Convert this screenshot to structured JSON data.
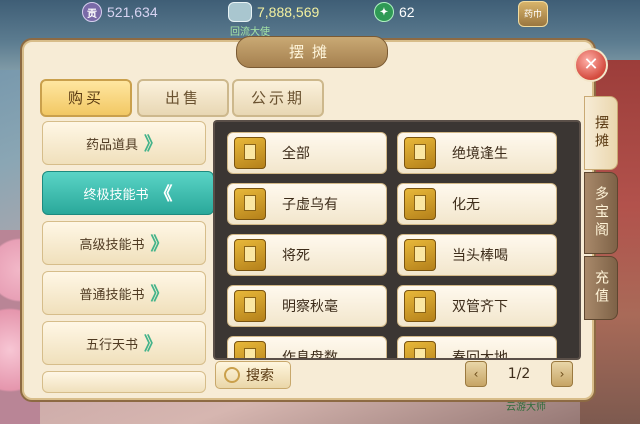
{
  "resources": {
    "gold": {
      "icon": "gold-coin-icon",
      "symbol": "贡",
      "value": "521,634"
    },
    "silver": {
      "icon": "silver-ingot-icon",
      "value": "7,888,569",
      "sublabel": "回流大使"
    },
    "jade": {
      "icon": "jade-icon",
      "value": "62"
    },
    "bag": {
      "icon": "treasure-bag-icon",
      "label": "药巾"
    }
  },
  "panel": {
    "title": "摆摊",
    "close_icon": "close-icon",
    "close_symbol": "✕"
  },
  "top_tabs": [
    {
      "label": "购买",
      "active": true
    },
    {
      "label": "出售",
      "active": false
    },
    {
      "label": "公示期",
      "active": false
    }
  ],
  "categories": [
    {
      "label": "药品道具",
      "chevron": "》",
      "active": false
    },
    {
      "label": "终极技能书",
      "chevron": "《",
      "active": true
    },
    {
      "label": "高级技能书",
      "chevron": "》",
      "active": false
    },
    {
      "label": "普通技能书",
      "chevron": "》",
      "active": false
    },
    {
      "label": "五行天书",
      "chevron": "》",
      "active": false
    }
  ],
  "items": [
    {
      "label": "全部",
      "icon": "skill-book-icon"
    },
    {
      "label": "绝境逢生",
      "icon": "skill-book-icon"
    },
    {
      "label": "子虚乌有",
      "icon": "skill-book-icon"
    },
    {
      "label": "化无",
      "icon": "skill-book-icon"
    },
    {
      "label": "将死",
      "icon": "skill-book-icon"
    },
    {
      "label": "当头棒喝",
      "icon": "skill-book-icon"
    },
    {
      "label": "明察秋毫",
      "icon": "skill-book-icon"
    },
    {
      "label": "双管齐下",
      "icon": "skill-book-icon"
    },
    {
      "label": "作息盘数",
      "icon": "skill-book-icon"
    },
    {
      "label": "春回大地",
      "icon": "skill-book-icon"
    }
  ],
  "search": {
    "label": "搜索",
    "icon": "search-icon"
  },
  "pager": {
    "prev": "‹",
    "next": "›",
    "text": "1/2"
  },
  "side_tabs": [
    {
      "label": "摆摊",
      "active": true
    },
    {
      "label": "多宝阁",
      "active": false
    },
    {
      "label": "充值",
      "active": false
    }
  ],
  "scene_labels": {
    "right_bottom": "云游大师"
  }
}
